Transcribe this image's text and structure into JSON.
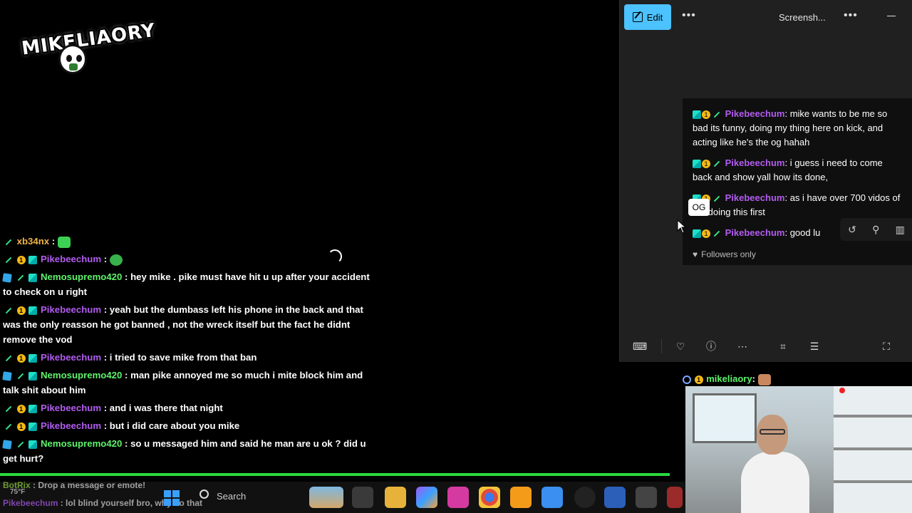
{
  "overlay": {
    "logo_text": "MIKELIAORY",
    "loading": true
  },
  "chat_left": {
    "partial_top": "...",
    "messages": [
      {
        "user": "xb34nx",
        "color": "orange",
        "text": "",
        "emote": "grin-emote"
      },
      {
        "user": "Pikebeechum",
        "color": "purple",
        "text": "",
        "emote": "clover-emote"
      },
      {
        "user": "Nemosupremo420",
        "color": "green",
        "text": "hey mike . pike must have hit u up after your accident to check on u right"
      },
      {
        "user": "Pikebeechum",
        "color": "purple",
        "text": "yeah but the dumbass left his phone in the back and that was the only reasson he got banned , not the wreck itself but the fact he didnt remove the vod"
      },
      {
        "user": "Pikebeechum",
        "color": "purple",
        "text": "i tried to save mike from that ban"
      },
      {
        "user": "Nemosupremo420",
        "color": "green",
        "text": "man pike annoyed me so much i mite block him and talk shit about him"
      },
      {
        "user": "Pikebeechum",
        "color": "purple",
        "text": "and i was there that night"
      },
      {
        "user": "Pikebeechum",
        "color": "purple",
        "text": "but i did care about you mike"
      },
      {
        "user": "Nemosupremo420",
        "color": "green",
        "text": "so u messaged him and said he man are u ok ? did u get hurt?"
      }
    ]
  },
  "snip": {
    "edit_label": "Edit",
    "more_label": "•••",
    "title": "Screensh...",
    "preview_messages": [
      {
        "user": "Pikebeechum",
        "text": "mike wants to be me so bad its funny, doing my thing here on kick, and acting like he's the og hahah"
      },
      {
        "user": "Pikebeechum",
        "text": "i guess i need to come back and show yall how its done,"
      },
      {
        "user": "Pikebeechum",
        "text": "as i have over 700 vidos of me doing this first"
      },
      {
        "user": "Pikebeechum",
        "text": "good lu"
      }
    ],
    "tooltip": "OG",
    "followers_only": "Followers only",
    "accent": "#4cc2ff"
  },
  "chat_right": {
    "user": "mikeliaory",
    "text": ""
  },
  "taskbar": {
    "search_label": "Search",
    "overlay_lines": [
      {
        "user": "BotRix",
        "text": "Drop a message or emote!"
      },
      {
        "user": "Pikebeechum",
        "text": "lol blind yourself bro, why do that"
      }
    ],
    "temp": "75°F"
  }
}
